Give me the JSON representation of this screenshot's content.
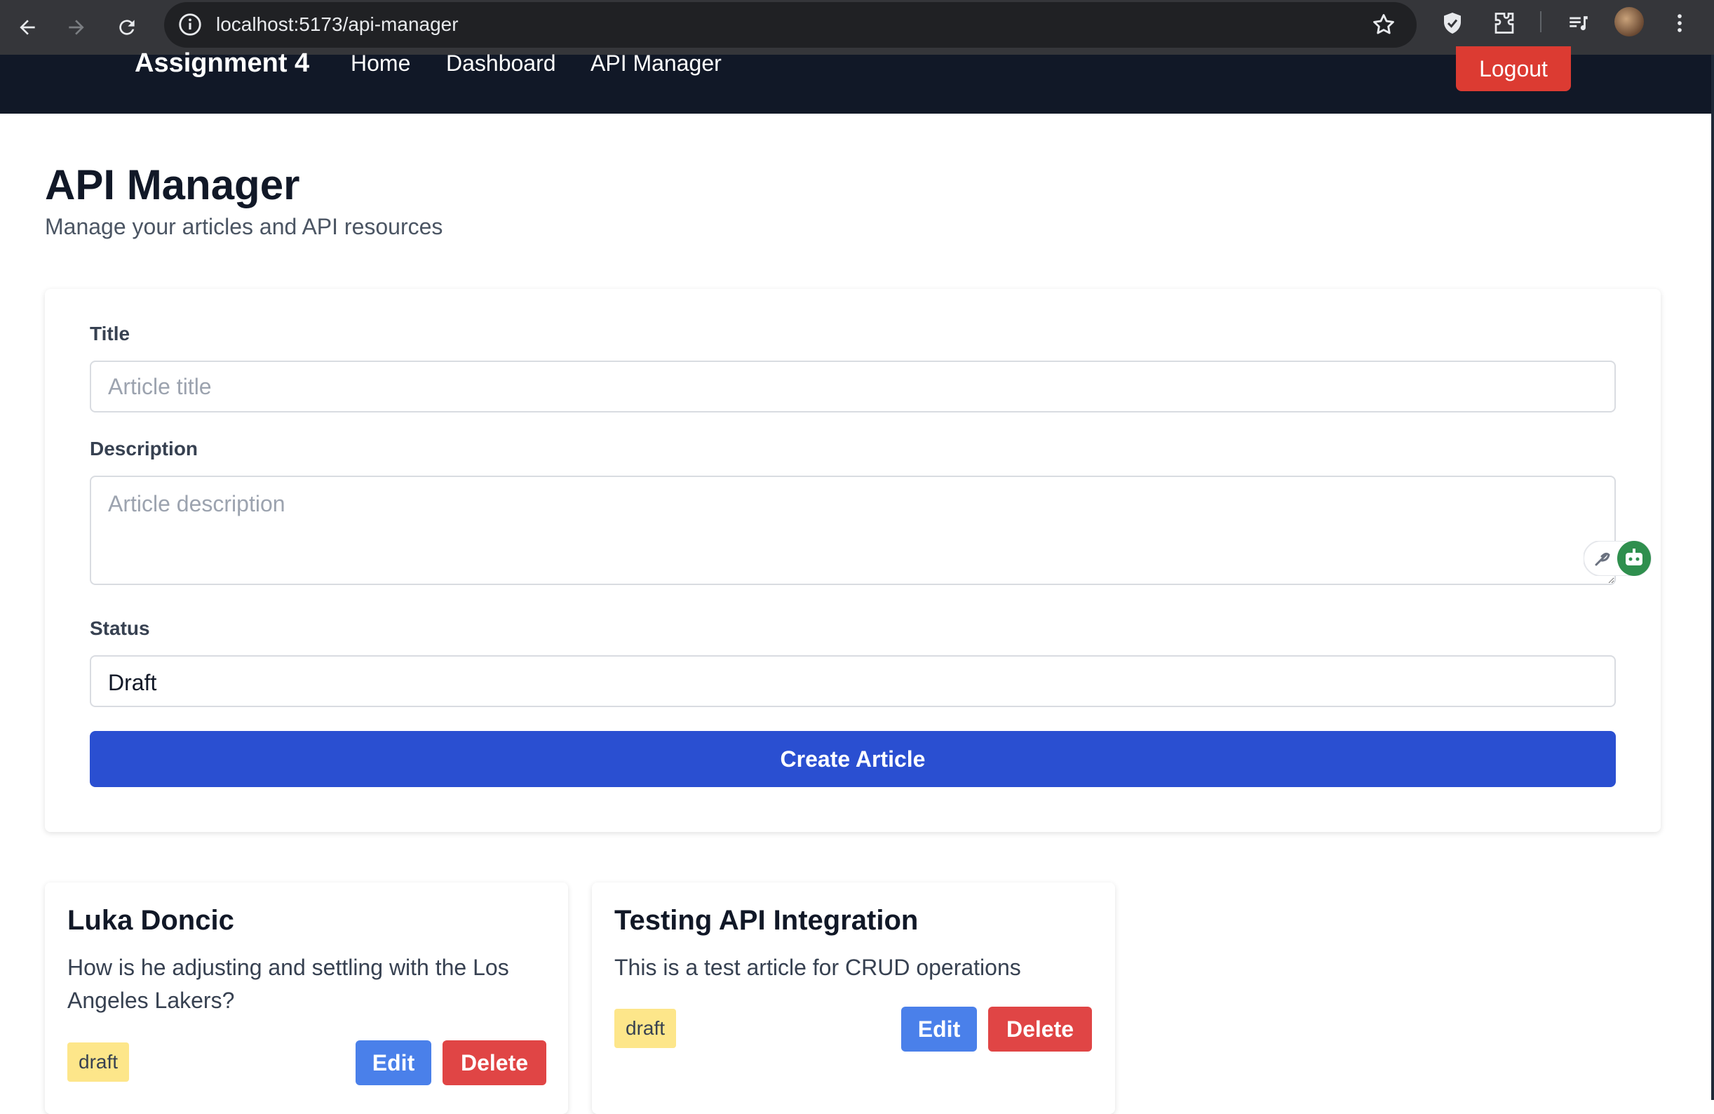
{
  "browser": {
    "url": "localhost:5173/api-manager"
  },
  "header": {
    "brand": "Assignment 4",
    "nav": [
      "Home",
      "Dashboard",
      "API Manager"
    ],
    "logout_label": "Logout"
  },
  "page": {
    "title": "API Manager",
    "subtitle": "Manage your articles and API resources"
  },
  "form": {
    "title_label": "Title",
    "title_placeholder": "Article title",
    "title_value": "",
    "description_label": "Description",
    "description_placeholder": "Article description",
    "description_value": "",
    "status_label": "Status",
    "status_value": "Draft",
    "submit_label": "Create Article"
  },
  "articles": [
    {
      "title": "Luka Doncic",
      "description": "How is he adjusting and settling with the Los Angeles Lakers?",
      "status": "draft",
      "edit_label": "Edit",
      "delete_label": "Delete"
    },
    {
      "title": "Testing API Integration",
      "description": "This is a test article for CRUD operations",
      "status": "draft",
      "edit_label": "Edit",
      "delete_label": "Delete"
    }
  ],
  "colors": {
    "header_bg": "#111827",
    "primary": "#2a4fd1",
    "edit": "#4a80ea",
    "danger": "#e04545",
    "draft_badge": "#fde68a"
  }
}
